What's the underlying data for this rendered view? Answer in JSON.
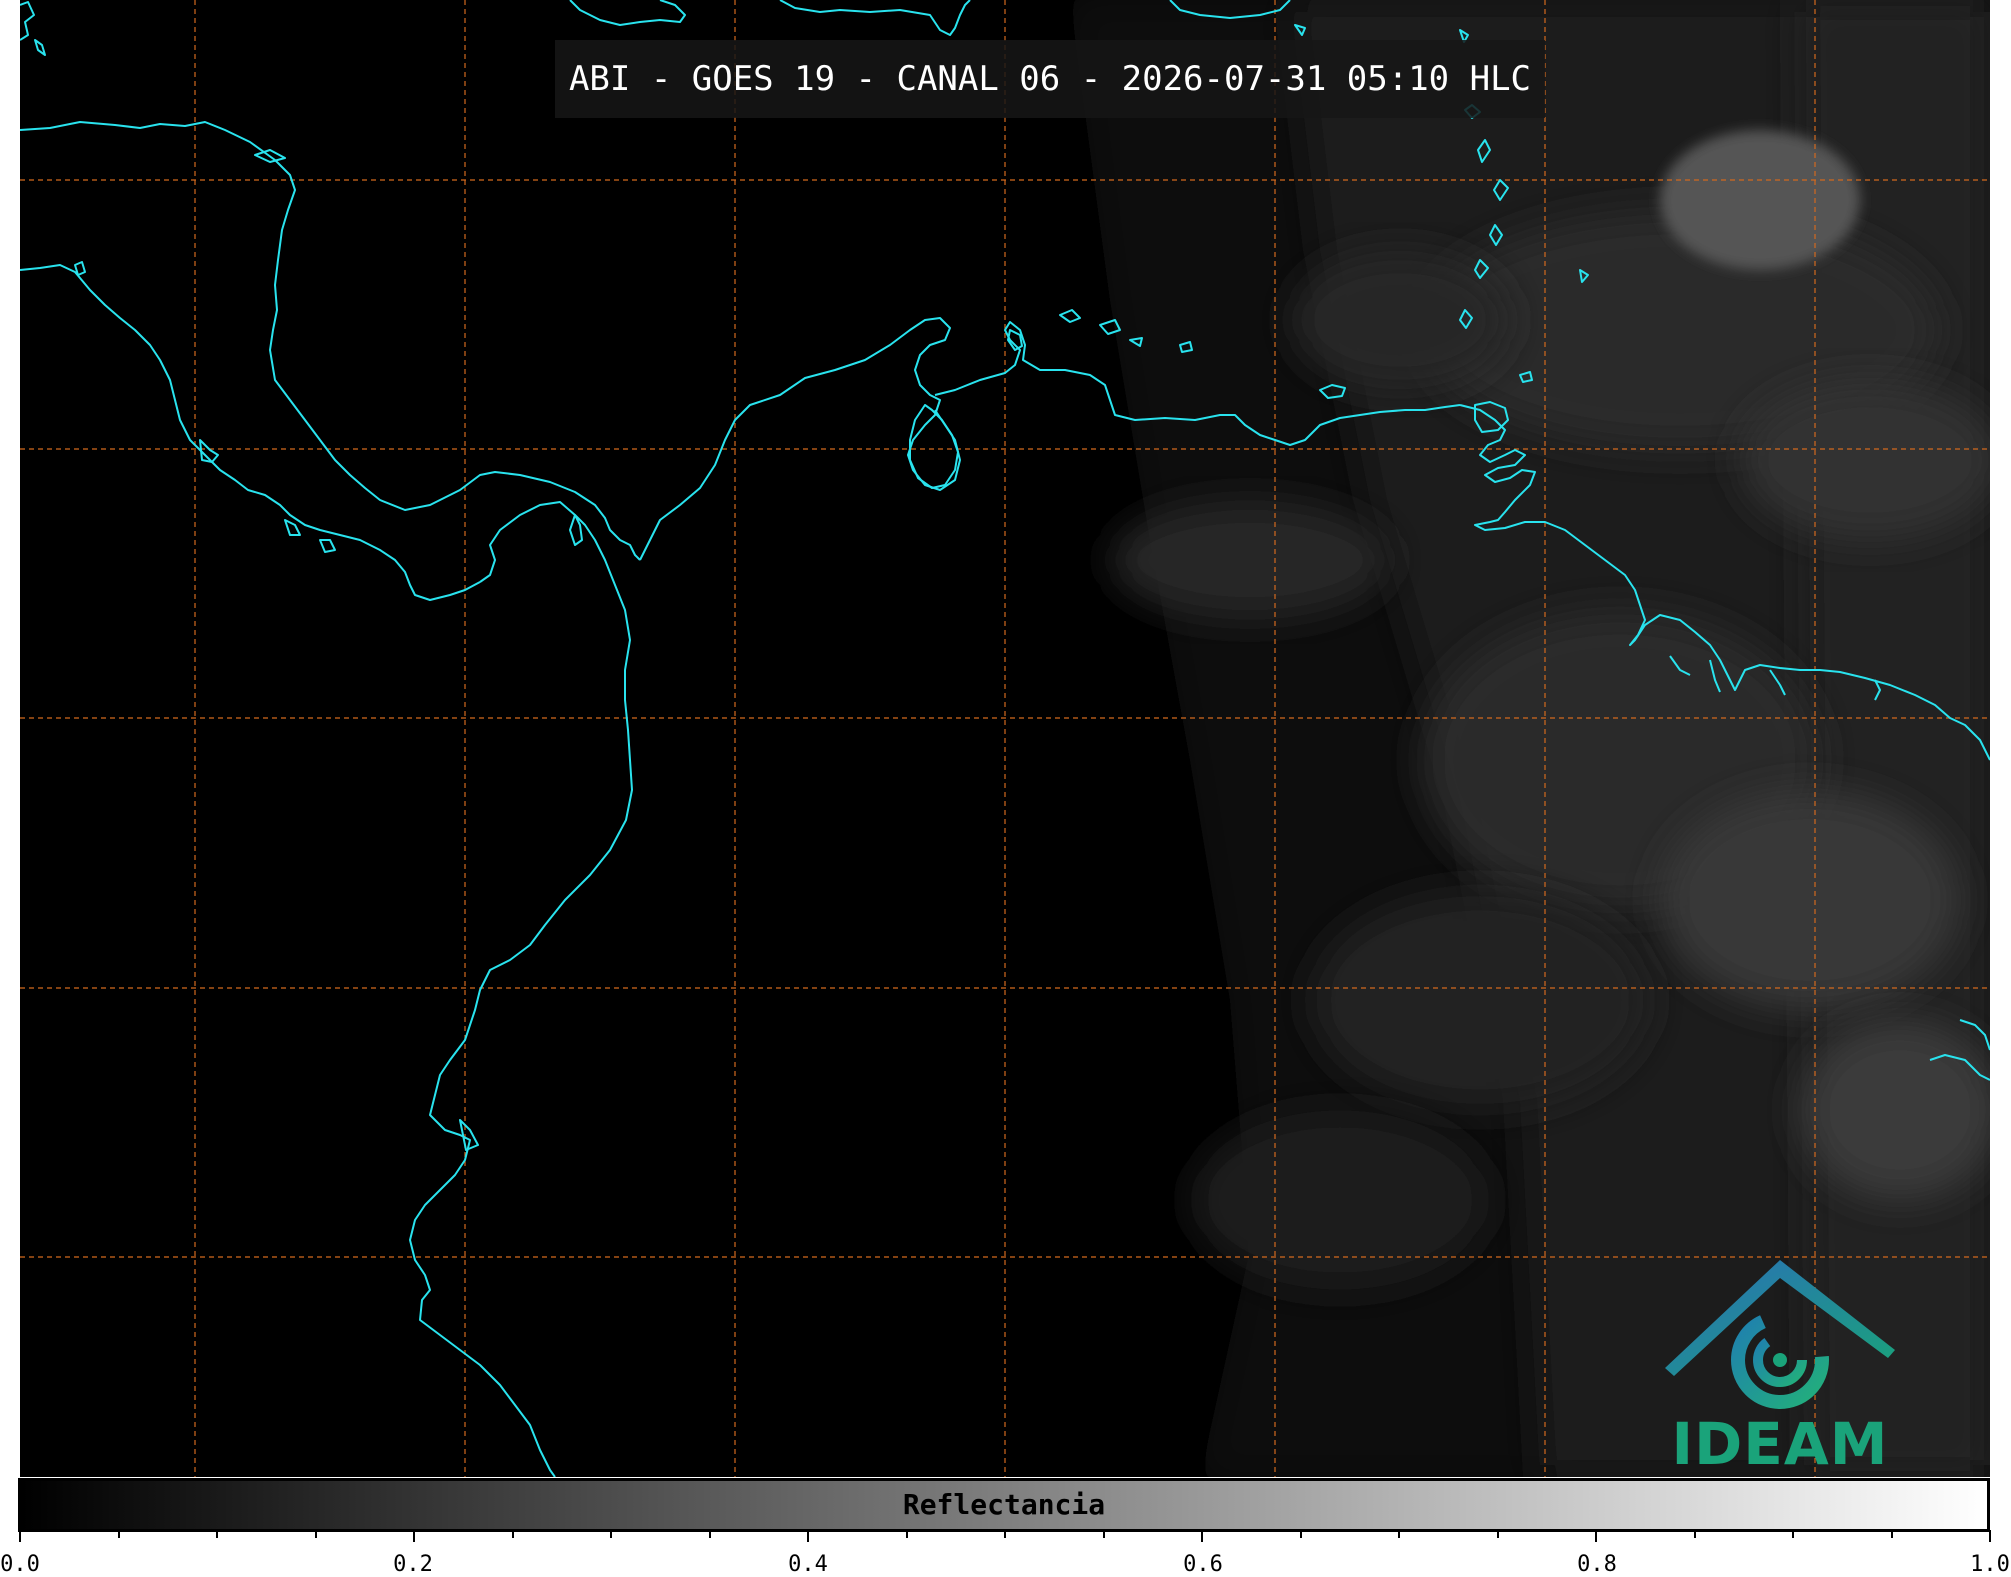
{
  "title": "ABI - GOES 19 - CANAL 06 - 2026-07-31 05:10 HLC",
  "logo": {
    "text": "IDEAM",
    "color": "#1aa37a",
    "icon": "ideam-logo-icon"
  },
  "colorbar": {
    "label": "Reflectancia",
    "min": 0.0,
    "max": 1.0,
    "tick_labels": [
      "0.0",
      "0.2",
      "0.4",
      "0.6",
      "0.8",
      "1.0"
    ],
    "colors": {
      "low": "#000000",
      "high": "#ffffff"
    }
  },
  "map": {
    "background": "#000000",
    "coastline_color": "#29e3ee",
    "grid_color": "#d2691e",
    "grid_style": "dashed"
  }
}
